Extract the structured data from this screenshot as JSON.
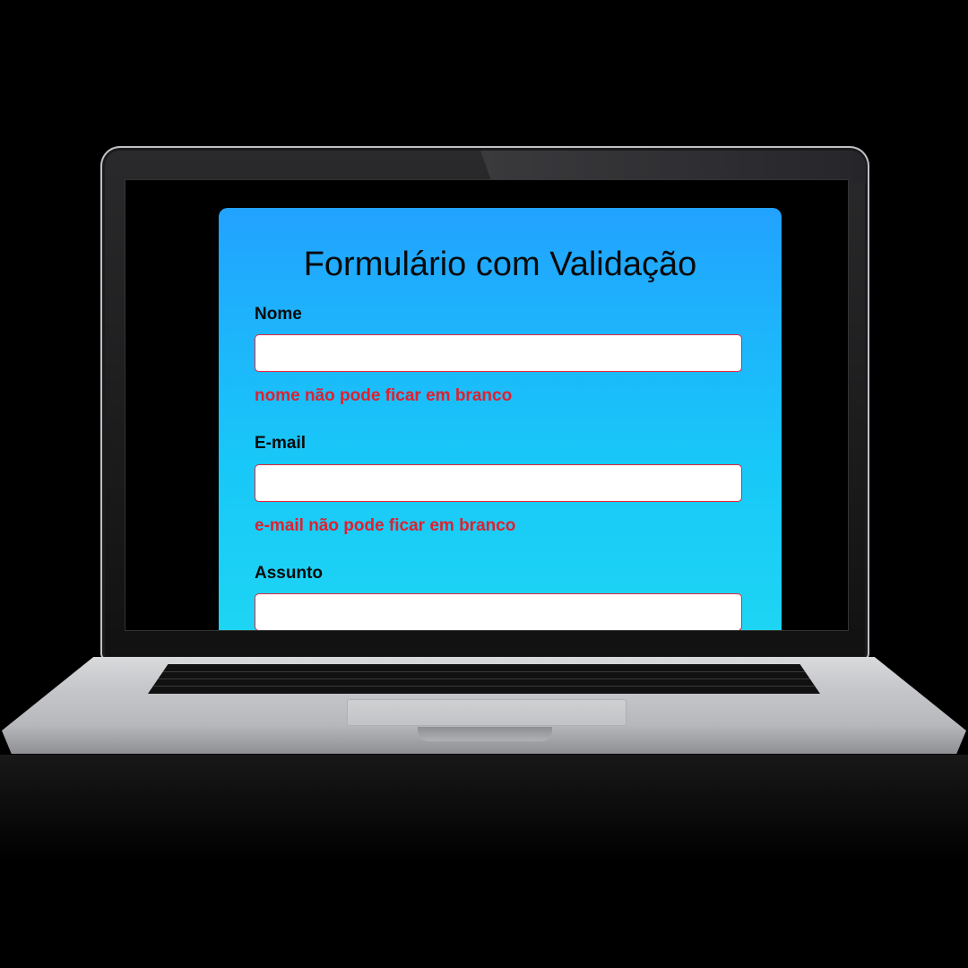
{
  "form": {
    "title": "Formulário com Validação",
    "fields": [
      {
        "label": "Nome",
        "value": "",
        "error": "nome não pode ficar em branco"
      },
      {
        "label": "E-mail",
        "value": "",
        "error": "e-mail não pode ficar em branco"
      },
      {
        "label": "Assunto",
        "value": "",
        "error": ""
      }
    ]
  },
  "colors": {
    "card_gradient_top": "#22a2ff",
    "card_gradient_bottom": "#1fd8f2",
    "error_text": "#e0202f",
    "input_border": "#e2263a"
  }
}
